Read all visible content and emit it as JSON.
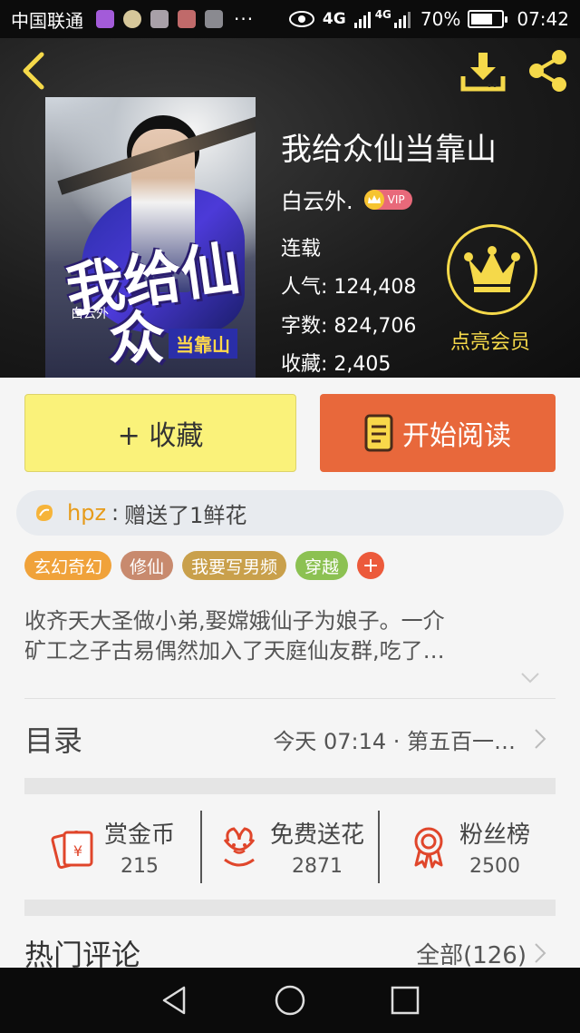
{
  "status_bar": {
    "carrier": "中国联通",
    "dots": "···",
    "network_1": "4G",
    "network_2": "4G",
    "battery": "70%",
    "battery_level": 0.7,
    "time": "07:42"
  },
  "book": {
    "title": "我给众仙当靠山",
    "author": "白云外.",
    "vip_badge": "VIP",
    "status": "连载",
    "popularity_label": "人气:",
    "popularity": "124,408",
    "words_label": "字数:",
    "words": "824,706",
    "favorites_label": "收藏:",
    "favorites": "2,405"
  },
  "cover": {
    "line1": "我给仙",
    "line2": "众",
    "subtitle": "当靠山",
    "author": "白云外"
  },
  "member": {
    "label": "点亮会员"
  },
  "actions": {
    "favorite": "+ 收藏",
    "read": "开始阅读"
  },
  "gift": {
    "user": "hpz",
    "separator": ":",
    "text": "赠送了1鲜花"
  },
  "tags": [
    {
      "label": "玄幻奇幻",
      "color": "#f0a23a"
    },
    {
      "label": "修仙",
      "color": "#c88a6e"
    },
    {
      "label": "我要写男频",
      "color": "#c9a04b"
    },
    {
      "label": "穿越",
      "color": "#8cc152"
    }
  ],
  "description": {
    "line1": "收齐天大圣做小弟,娶嫦娥仙子为娘子。一介",
    "line2": "矿工之子古易偶然加入了天庭仙友群,吃了…"
  },
  "toc": {
    "label": "目录",
    "value": "今天 07:14 · 第五百一…"
  },
  "stats": [
    {
      "label": "赏金币",
      "value": "215",
      "icon": "red-envelope-icon"
    },
    {
      "label": "免费送花",
      "value": "2871",
      "icon": "flower-icon"
    },
    {
      "label": "粉丝榜",
      "value": "2500",
      "icon": "medal-icon"
    }
  ],
  "hot_comments": {
    "label": "热门评论",
    "value": "全部(126)"
  },
  "colors": {
    "accent_yellow": "#faf27a",
    "accent_orange": "#e8683b",
    "gold": "#f5d94a",
    "icon_red": "#e0462b"
  }
}
